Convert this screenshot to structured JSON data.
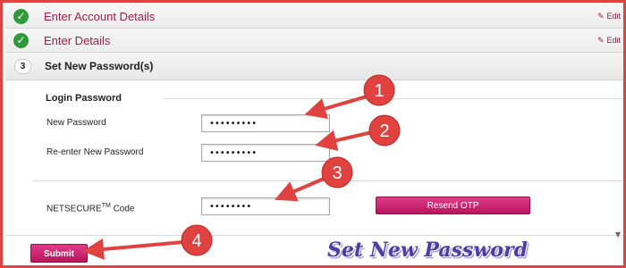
{
  "steps": [
    {
      "label": "Enter Account Details",
      "edit": "Edit",
      "icon": "check-icon"
    },
    {
      "label": "Enter Details",
      "edit": "Edit",
      "icon": "check-icon"
    }
  ],
  "current_step": {
    "number": "3",
    "label": "Set New Password(s)"
  },
  "login_password": {
    "section_title": "Login Password",
    "new_password_label": "New Password",
    "new_password_value": "•••••••••",
    "reenter_label": "Re-enter New Password",
    "reenter_value": "•••••••••"
  },
  "netsecure": {
    "label_main": "NETSECURE",
    "label_sup": "TM",
    "label_suffix": " Code",
    "value": "••••••••",
    "resend_label": "Resend OTP"
  },
  "submit_label": "Submit",
  "caption": "Set New Password",
  "annotations": [
    "1",
    "2",
    "3",
    "4"
  ],
  "colors": {
    "accent": "#c4186a",
    "arrow": "#e0433f",
    "check": "#2e9a3a",
    "caption": "#4b3fa3"
  }
}
